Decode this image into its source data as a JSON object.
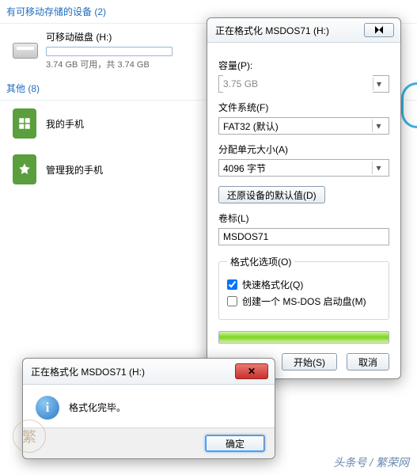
{
  "sections": {
    "removable_header": "有可移动存储的设备 (2)",
    "other_header": "其他 (8)"
  },
  "drive": {
    "name": "可移动磁盘 (H:)",
    "storage_text": "3.74 GB 可用，共 3.74 GB"
  },
  "phones": {
    "my_phone": "我的手机",
    "manage_phone": "管理我的手机"
  },
  "format_dialog": {
    "title": "正在格式化 MSDOS71 (H:)",
    "close_glyph": "⏵⏴",
    "capacity_label": "容量(P):",
    "capacity_value": "3.75 GB",
    "filesystem_label": "文件系统(F)",
    "filesystem_value": "FAT32 (默认)",
    "alloc_label": "分配单元大小(A)",
    "alloc_value": "4096 字节",
    "restore_btn": "还原设备的默认值(D)",
    "volume_label": "卷标(L)",
    "volume_value": "MSDOS71",
    "options_legend": "格式化选项(O)",
    "quick_format": "快速格式化(Q)",
    "create_dos": "创建一个 MS-DOS 启动盘(M)",
    "start_btn": "开始(S)",
    "cancel_btn": "取消"
  },
  "msg_dialog": {
    "title": "正在格式化 MSDOS71 (H:)",
    "message": "格式化完毕。",
    "ok_btn": "确定",
    "close_x": "✕"
  },
  "footer": "头条号 / 繁荣网",
  "chevron": "▾"
}
